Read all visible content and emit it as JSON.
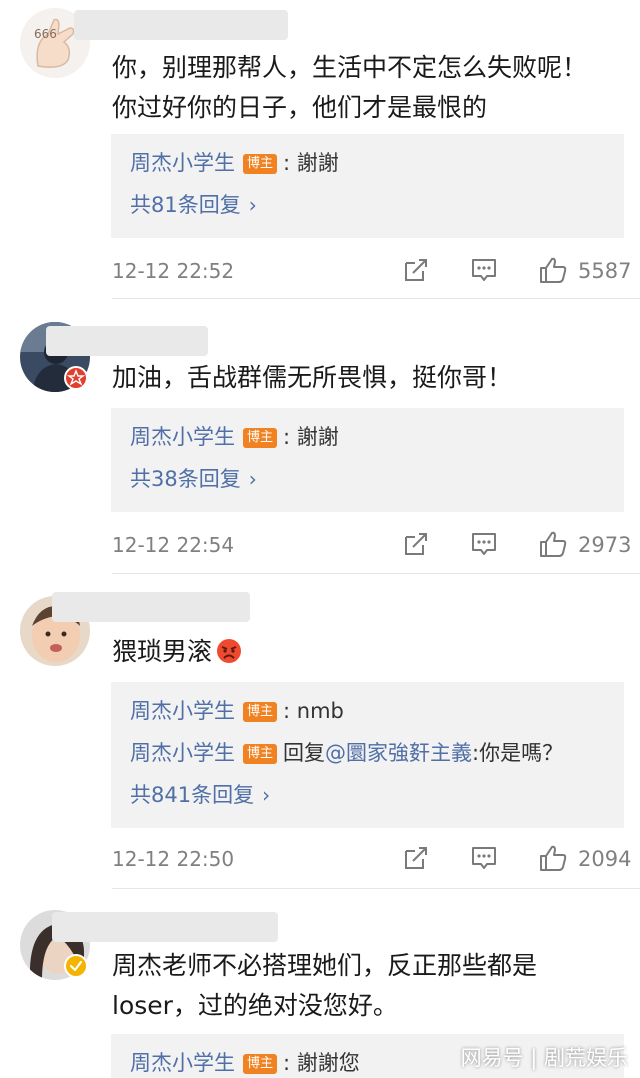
{
  "colors": {
    "author_link": "#4f6fa6",
    "host_tag_bg": "#f08222",
    "meta_gray": "#808080",
    "reply_bg": "#f2f2f2"
  },
  "host_tag": "博主",
  "comments": [
    {
      "text_lines": [
        "你，别理那帮人，生活中不定怎么失败呢！",
        "你过好你的日子，他们才是最恨的"
      ],
      "replies": [
        {
          "author": "周杰小学生",
          "text": ": 謝謝"
        }
      ],
      "more_replies": "共81条回复",
      "time": "12-12 22:52",
      "likes": "5587",
      "icons": [
        "share-icon",
        "comment-icon",
        "like-icon"
      ]
    },
    {
      "text_lines": [
        "加油，舌战群儒无所畏惧，挺你哥！"
      ],
      "replies": [
        {
          "author": "周杰小学生",
          "text": ": 謝謝"
        }
      ],
      "more_replies": "共38条回复",
      "time": "12-12 22:54",
      "likes": "2973",
      "icons": [
        "share-icon",
        "comment-icon",
        "like-icon"
      ]
    },
    {
      "text_lines": [
        "猥琐男滚"
      ],
      "replies": [
        {
          "author": "周杰小学生",
          "text": ": nmb"
        },
        {
          "author": "周杰小学生",
          "prefix": "回复",
          "mention": "@圜家強姧主義",
          "text": ":你是嗎？"
        }
      ],
      "more_replies": "共841条回复",
      "time": "12-12 22:50",
      "likes": "2094",
      "icons": [
        "share-icon",
        "comment-icon",
        "like-icon"
      ]
    },
    {
      "text_lines": [
        "周杰老师不必搭理她们，反正那些都是",
        "loser，过的绝对没您好。"
      ],
      "replies": [
        {
          "author": "周杰小学生",
          "text": ": 謝謝您"
        }
      ]
    }
  ],
  "watermark": "网易号 | 剧荒娱乐"
}
